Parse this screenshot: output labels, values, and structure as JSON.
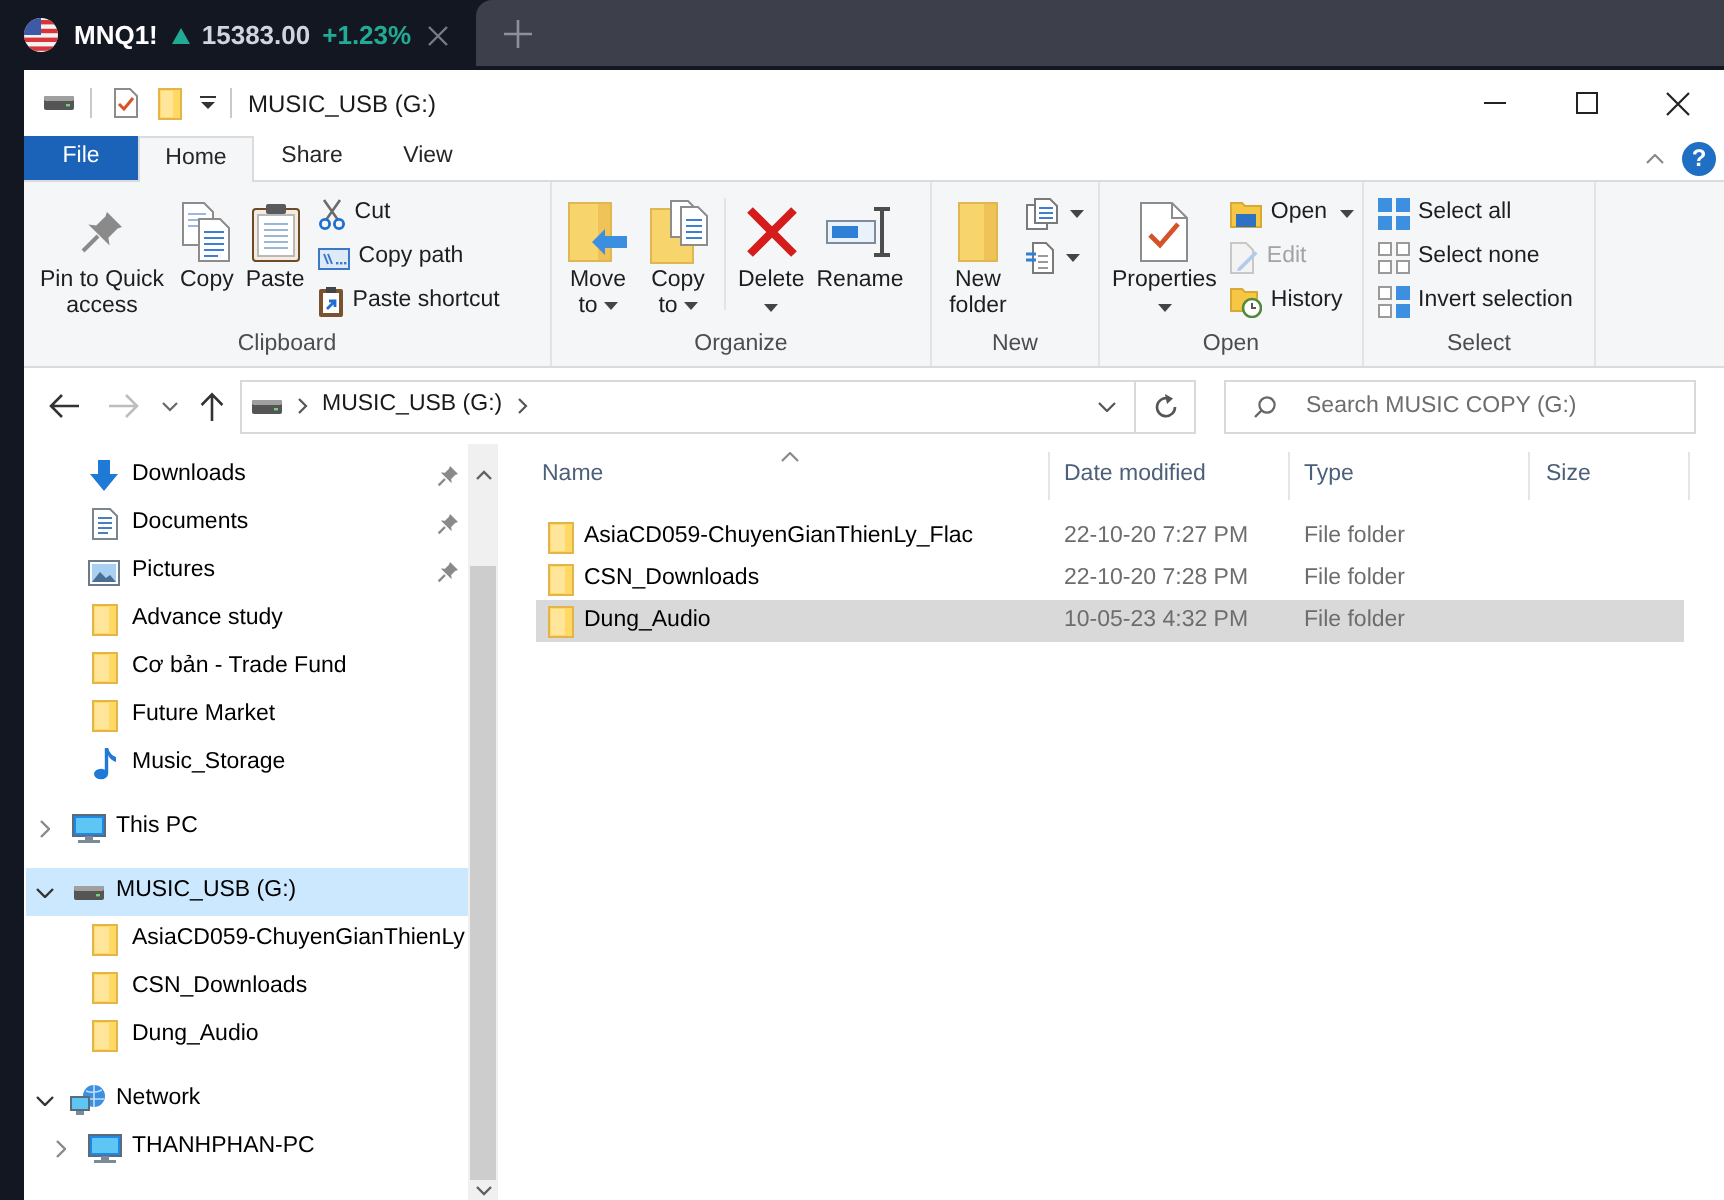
{
  "browser_tab": {
    "symbol": "MNQ1!",
    "rising": true,
    "price": "15383.00",
    "change": "+1.23%"
  },
  "window": {
    "title": "MUSIC_USB (G:)"
  },
  "ribbon_tabs": [
    {
      "label": "File",
      "kind": "menu",
      "selected": false
    },
    {
      "label": "Home",
      "kind": "tab",
      "selected": true
    },
    {
      "label": "Share",
      "kind": "tab",
      "selected": false
    },
    {
      "label": "View",
      "kind": "tab",
      "selected": false
    }
  ],
  "help": {
    "label": "?"
  },
  "ribbon_groups": [
    {
      "label": "Clipboard",
      "items": [
        {
          "kind": "large",
          "label": "Pin to Quick access",
          "dropdown": false
        },
        {
          "kind": "large",
          "label": "Copy",
          "dropdown": false
        },
        {
          "kind": "large",
          "label": "Paste",
          "dropdown": false
        },
        {
          "kind": "stack",
          "items": [
            {
              "label": "Cut",
              "dropdown": false,
              "disabled": false
            },
            {
              "label": "Copy path",
              "dropdown": false,
              "disabled": false
            },
            {
              "label": "Paste shortcut",
              "dropdown": false,
              "disabled": false
            }
          ]
        }
      ]
    },
    {
      "label": "Organize",
      "items": [
        {
          "kind": "large",
          "label": "Move to",
          "dropdown": true
        },
        {
          "kind": "large",
          "label": "Copy to",
          "dropdown": true
        },
        {
          "kind": "separator"
        },
        {
          "kind": "large",
          "label": "Delete",
          "dropdown": true
        },
        {
          "kind": "large",
          "label": "Rename",
          "dropdown": false
        }
      ]
    },
    {
      "label": "New",
      "items": [
        {
          "kind": "large",
          "label": "New folder",
          "dropdown": false
        },
        {
          "kind": "stack",
          "items": [
            {
              "dropdown": true,
              "disabled": false
            },
            {
              "dropdown": true,
              "disabled": false
            }
          ]
        }
      ]
    },
    {
      "label": "Open",
      "items": [
        {
          "kind": "large",
          "label": "Properties",
          "dropdown": true
        },
        {
          "kind": "stack",
          "items": [
            {
              "label": "Open",
              "dropdown": true,
              "disabled": false
            },
            {
              "label": "Edit",
              "dropdown": false,
              "disabled": true
            },
            {
              "label": "History",
              "dropdown": false,
              "disabled": false
            }
          ]
        }
      ]
    },
    {
      "label": "Select",
      "items": [
        {
          "kind": "stack",
          "items": [
            {
              "label": "Select all",
              "dropdown": false,
              "disabled": false
            },
            {
              "label": "Select none",
              "dropdown": false,
              "disabled": false
            },
            {
              "label": "Invert selection",
              "dropdown": false,
              "disabled": false
            }
          ]
        }
      ]
    }
  ],
  "address_bar": {
    "can_go_back": true,
    "can_go_forward": false,
    "path": [
      "MUSIC_USB (G:)"
    ]
  },
  "search": {
    "placeholder": "Search MUSIC COPY (G:)"
  },
  "nav": {
    "quick_access": [
      {
        "label": "Downloads",
        "kind": "downloads",
        "pinned": true,
        "selected": false
      },
      {
        "label": "Documents",
        "kind": "documents",
        "pinned": true,
        "selected": false
      },
      {
        "label": "Pictures",
        "kind": "pictures",
        "pinned": true,
        "selected": false
      },
      {
        "label": "Advance study",
        "kind": "folder",
        "pinned": false,
        "selected": false
      },
      {
        "label": "Cơ bản - Trade Fund",
        "kind": "folder",
        "pinned": false,
        "selected": false
      },
      {
        "label": "Future Market",
        "kind": "folder",
        "pinned": false,
        "selected": false
      },
      {
        "label": "Music_Storage",
        "kind": "music",
        "pinned": false,
        "selected": false
      }
    ],
    "tree": [
      {
        "label": "This PC",
        "kind": "pc",
        "expanded": false,
        "selected": false
      },
      {
        "label": "MUSIC_USB (G:)",
        "kind": "drive",
        "expanded": true,
        "selected": true,
        "children": [
          {
            "label": "AsiaCD059-ChuyenGianThienLy",
            "kind": "folder",
            "selected": false
          },
          {
            "label": "CSN_Downloads",
            "kind": "folder",
            "selected": false
          },
          {
            "label": "Dung_Audio",
            "kind": "folder",
            "selected": false
          }
        ]
      },
      {
        "label": "Network",
        "kind": "network",
        "expanded": true,
        "selected": false,
        "children": [
          {
            "label": "THANHPHAN-PC",
            "kind": "pc",
            "expanded": false,
            "selected": false
          }
        ]
      }
    ]
  },
  "files": {
    "columns": [
      {
        "label": "Name",
        "sorted": true
      },
      {
        "label": "Date modified",
        "sorted": false
      },
      {
        "label": "Type",
        "sorted": false
      },
      {
        "label": "Size",
        "sorted": false
      }
    ],
    "rows": [
      {
        "name": "AsiaCD059-ChuyenGianThienLy_Flac",
        "date_modified": "22-10-20 7:27 PM",
        "type": "File folder",
        "selected": false
      },
      {
        "name": "CSN_Downloads",
        "date_modified": "22-10-20 7:28 PM",
        "type": "File folder",
        "selected": false
      },
      {
        "name": "Dung_Audio",
        "date_modified": "10-05-23 4:32 PM",
        "type": "File folder",
        "selected": true
      }
    ]
  }
}
